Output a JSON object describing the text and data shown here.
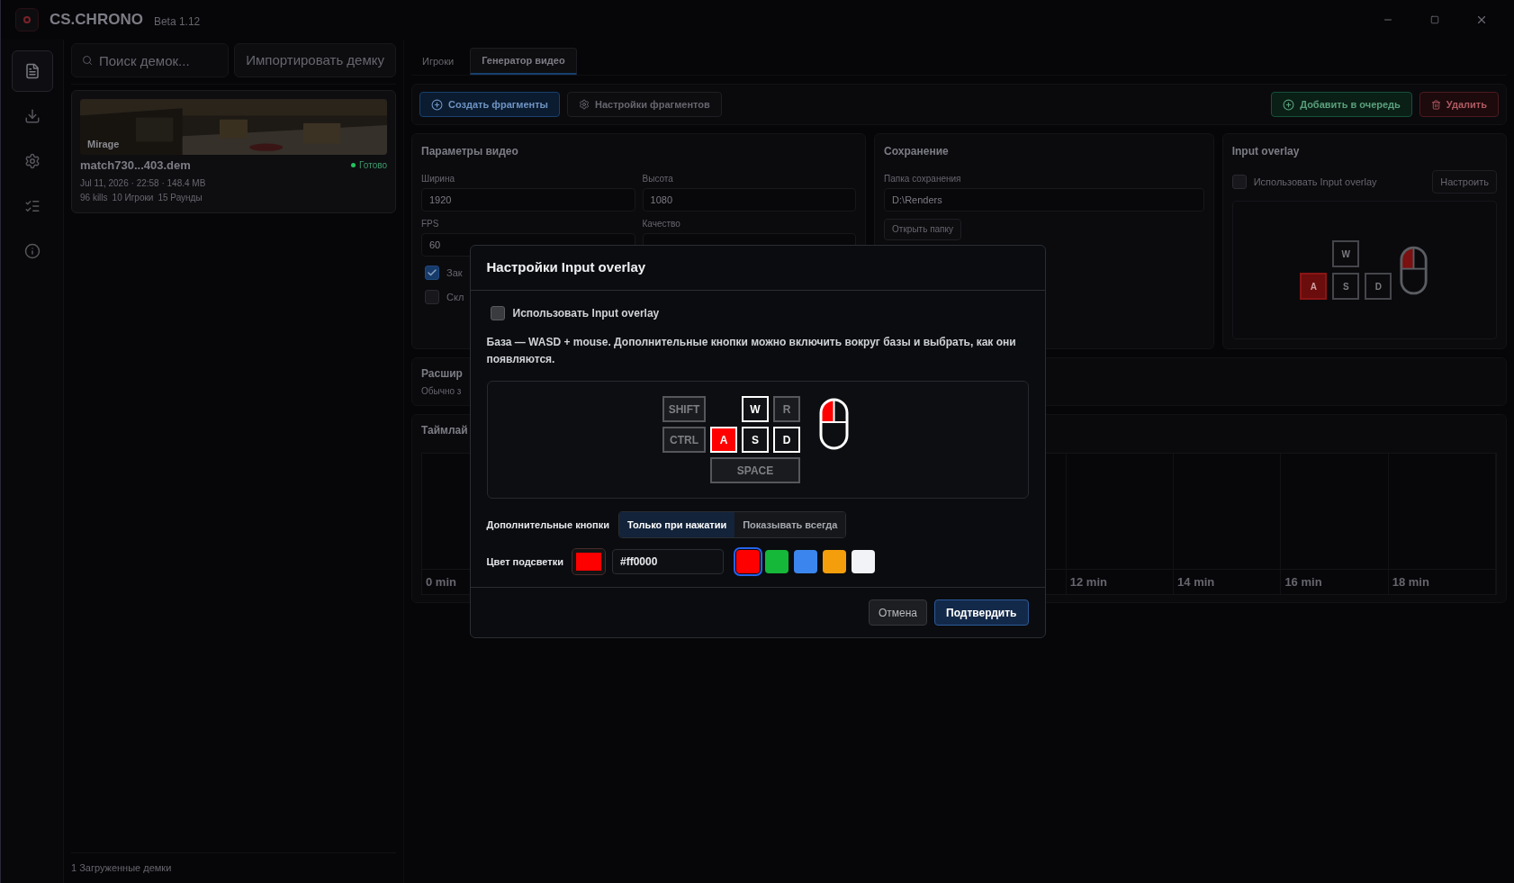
{
  "app": {
    "title": "CS.CHRONO",
    "version": "Beta 1.12"
  },
  "rail": [
    {
      "kind": "document",
      "selected": true
    },
    {
      "kind": "download",
      "selected": false
    },
    {
      "kind": "settings",
      "selected": false
    },
    {
      "kind": "list",
      "selected": false
    },
    {
      "kind": "info",
      "selected": false
    }
  ],
  "demos": {
    "search_placeholder": "Поиск демок...",
    "import_button": "Импортировать демку",
    "items": [
      {
        "map": "Mirage",
        "file": "match730...403.dem",
        "status": "Готово",
        "color": "#22c55e",
        "meta": "Jul 11, 2026 · 22:58 · 148.4 MB",
        "stats": [
          "96 kills",
          "10 Игроки",
          "15 Раунды"
        ],
        "selected": true
      }
    ],
    "footer": "1 Загруженные демки"
  },
  "tabs": [
    {
      "label": "Игроки",
      "selected": false
    },
    {
      "label": "Генератор видео",
      "selected": true
    }
  ],
  "toolbar": {
    "left": [
      {
        "label": "Создать фрагменты",
        "kind": "primary"
      },
      {
        "label": "Настройки фрагментов",
        "kind": "secondary"
      }
    ],
    "right": [
      {
        "label": "Добавить в очередь",
        "kind": "success"
      },
      {
        "label": "Удалить",
        "kind": "danger"
      }
    ]
  },
  "video": {
    "title": "Параметры видео",
    "fields": [
      {
        "label": "Ширина",
        "value": "1920"
      },
      {
        "label": "Высота",
        "value": "1080"
      },
      {
        "label": "FPS",
        "value": "60"
      },
      {
        "label": "Качество"
      }
    ],
    "checks": [
      {
        "label": "Зак",
        "checked": true
      },
      {
        "label": "Скл",
        "checked": false
      }
    ]
  },
  "save": {
    "title": "Сохранение",
    "folder_label": "Папка сохранения",
    "folder": "D:\\Renders",
    "open_button": "Открыть папку"
  },
  "overlay_card": {
    "title": "Input overlay",
    "checkbox": {
      "label": "Использовать Input overlay",
      "checked": false
    },
    "configure_button": "Настроить",
    "keys": [
      {
        "label": "W",
        "pressed": false
      },
      {
        "label": "A",
        "pressed": true
      },
      {
        "label": "S",
        "pressed": false
      },
      {
        "label": "D",
        "pressed": false
      }
    ],
    "mouse": {
      "left_pressed": true,
      "right_pressed": false
    }
  },
  "advanced": {
    "title": "Расшир",
    "hint": "Обычно з"
  },
  "timeline": {
    "title": "Таймлай",
    "ticks": [
      "0 min",
      "12 min",
      "14 min",
      "16 min",
      "18 min"
    ]
  },
  "dialog": {
    "title": "Настройки Input overlay",
    "checkbox": {
      "label": "Использовать Input overlay",
      "checked": false
    },
    "description": "База — WASD + mouse. Дополнительные кнопки можно включить вокруг базы и выбрать, как они появляются.",
    "keys": [
      {
        "label": "SHIFT",
        "enabled": false,
        "pressed": false
      },
      {
        "label": "W",
        "enabled": true,
        "pressed": false
      },
      {
        "label": "R",
        "enabled": false,
        "pressed": false
      },
      {
        "label": "CTRL",
        "enabled": false,
        "pressed": false
      },
      {
        "label": "A",
        "enabled": true,
        "pressed": true
      },
      {
        "label": "S",
        "enabled": true,
        "pressed": false
      },
      {
        "label": "D",
        "enabled": true,
        "pressed": false
      },
      {
        "label": "SPACE",
        "enabled": false,
        "pressed": false
      }
    ],
    "mouse": {
      "left_pressed": true,
      "right_pressed": false
    },
    "extra_label": "Дополнительные кнопки",
    "extra_options": [
      {
        "label": "Только при нажатии",
        "selected": true
      },
      {
        "label": "Показывать всегда",
        "selected": false
      }
    ],
    "color_label": "Цвет подсветки",
    "color": "#ff0000",
    "hex": "#ff0000",
    "presets": [
      {
        "color": "#ff0000",
        "selected": true
      },
      {
        "color": "#16b83a",
        "selected": false
      },
      {
        "color": "#3b86ee",
        "selected": false
      },
      {
        "color": "#f59e0b",
        "selected": false
      },
      {
        "color": "#f1f3f6",
        "selected": false
      }
    ],
    "cancel": "Отмена",
    "confirm": "Подтвердить"
  }
}
